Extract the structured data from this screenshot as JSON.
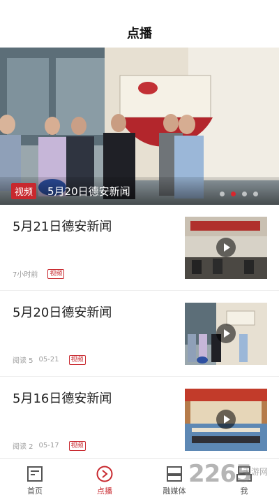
{
  "header": {
    "title": "点播"
  },
  "banner": {
    "tag": "视频",
    "title": "5月20日德安新闻",
    "dots": 4,
    "active_dot": 1
  },
  "items": [
    {
      "title": "5月21日德安新闻",
      "meta": [
        "7小时前"
      ],
      "tag": "视频"
    },
    {
      "title": "5月20日德安新闻",
      "meta": [
        "阅读 5",
        "05-21"
      ],
      "tag": "视频"
    },
    {
      "title": "5月16日德安新闻",
      "meta": [
        "阅读 2",
        "05-17"
      ],
      "tag": "视频"
    }
  ],
  "tabs": [
    {
      "label": "首页",
      "icon": "home-icon"
    },
    {
      "label": "点播",
      "icon": "play-circle-icon",
      "active": true
    },
    {
      "label": "融媒体",
      "icon": "media-icon"
    },
    {
      "label": "我",
      "icon": "user-icon"
    }
  ],
  "watermark": {
    "number": "2265",
    "text": "手游网"
  },
  "colors": {
    "accent": "#c8282e",
    "text": "#222222",
    "meta": "#9a9a9a"
  }
}
